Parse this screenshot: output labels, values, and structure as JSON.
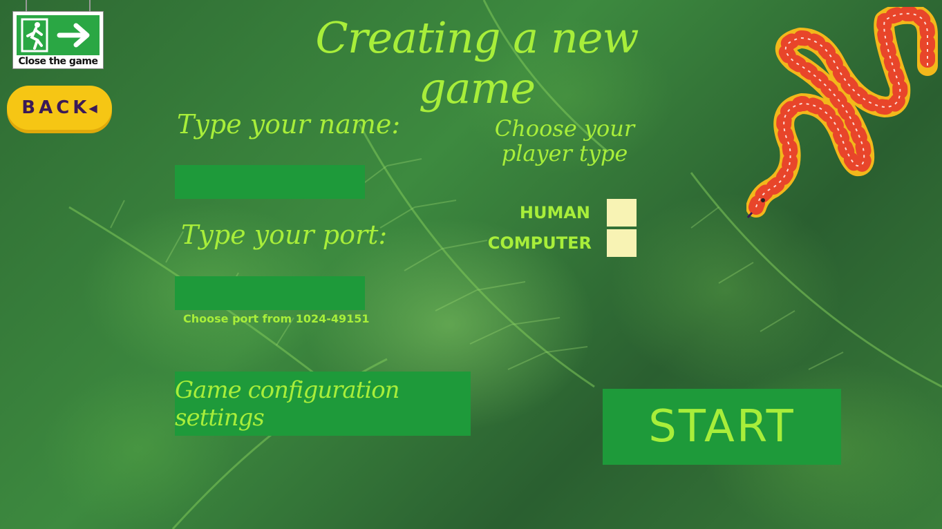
{
  "title": "Creating a new game",
  "close_button": {
    "label": "Close the game",
    "icon": "exit-sign-icon"
  },
  "back_button": {
    "label": "BACK",
    "icon": "triangle-left-icon"
  },
  "name": {
    "label": "Type your name:",
    "value": ""
  },
  "port": {
    "label": "Type your port:",
    "value": "",
    "hint": "Choose port from 1024-49151"
  },
  "player_type": {
    "label": "Choose your player type",
    "options": [
      {
        "label": "HUMAN",
        "checked": false
      },
      {
        "label": "COMPUTER",
        "checked": false
      }
    ]
  },
  "config_button": {
    "label": "Game configuration settings"
  },
  "start_button": {
    "label": "START"
  },
  "colors": {
    "text_green": "#a8ee3a",
    "panel_green": "#1e9a3a",
    "checkbox": "#f8f3b4",
    "back_yellow": "#f6c614",
    "back_text": "#3b1a57"
  }
}
